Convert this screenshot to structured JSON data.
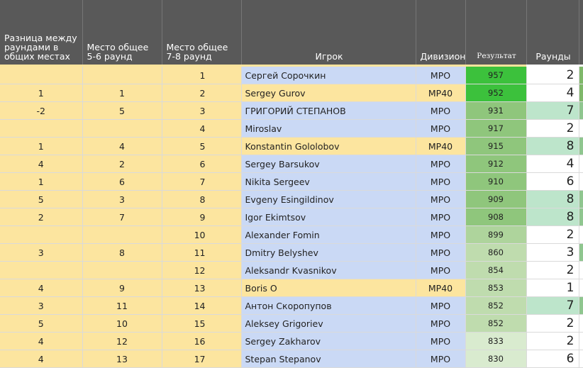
{
  "headers": {
    "diff": "Разница между раундами в общих местах",
    "place56": "Место общее 5-6 раунд",
    "place78": "Место общее 7-8 раунд",
    "player": "Игрок",
    "division": "Дивизион",
    "result": "Результат",
    "rounds": "Раунды"
  },
  "colors": {
    "header_bg": "#595959",
    "yellow": "#fce59f",
    "blue": "#cad9f5",
    "mint": "#bde5cb"
  },
  "rows": [
    {
      "diff": "",
      "p56": "",
      "p78": "1",
      "name": "Сергей Сорочкин",
      "division": "MPO",
      "result": "957",
      "rounds": "2"
    },
    {
      "diff": "1",
      "p56": "1",
      "p78": "2",
      "name": "Sergey Gurov",
      "division": "MP40",
      "result": "952",
      "rounds": "4"
    },
    {
      "diff": "-2",
      "p56": "5",
      "p78": "3",
      "name": "ГРИГОРИЙ СТЕПАНОВ",
      "division": "MPO",
      "result": "931",
      "rounds": "7"
    },
    {
      "diff": "",
      "p56": "",
      "p78": "4",
      "name": "Miroslav",
      "division": "MPO",
      "result": "917",
      "rounds": "2"
    },
    {
      "diff": "1",
      "p56": "4",
      "p78": "5",
      "name": "Konstantin Gololobov",
      "division": "MP40",
      "result": "915",
      "rounds": "8"
    },
    {
      "diff": "4",
      "p56": "2",
      "p78": "6",
      "name": "Sergey Barsukov",
      "division": "MPO",
      "result": "912",
      "rounds": "4"
    },
    {
      "diff": "1",
      "p56": "6",
      "p78": "7",
      "name": "Nikita Sergeev",
      "division": "MPO",
      "result": "910",
      "rounds": "6"
    },
    {
      "diff": "5",
      "p56": "3",
      "p78": "8",
      "name": "Evgeny Esingildinov",
      "division": "MPO",
      "result": "909",
      "rounds": "8"
    },
    {
      "diff": "2",
      "p56": "7",
      "p78": "9",
      "name": "Igor Ekimtsov",
      "division": "MPO",
      "result": "908",
      "rounds": "8"
    },
    {
      "diff": "",
      "p56": "",
      "p78": "10",
      "name": "Alexander Fomin",
      "division": "MPO",
      "result": "899",
      "rounds": "2"
    },
    {
      "diff": "3",
      "p56": "8",
      "p78": "11",
      "name": "Dmitry Belyshev",
      "division": "MPO",
      "result": "860",
      "rounds": "3"
    },
    {
      "diff": "",
      "p56": "",
      "p78": "12",
      "name": "Aleksandr Kvasnikov",
      "division": "MPO",
      "result": "854",
      "rounds": "2"
    },
    {
      "diff": "4",
      "p56": "9",
      "p78": "13",
      "name": "Boris O",
      "division": "MP40",
      "result": "853",
      "rounds": "1"
    },
    {
      "diff": "3",
      "p56": "11",
      "p78": "14",
      "name": "Антон Скоропупов",
      "division": "MPO",
      "result": "852",
      "rounds": "7"
    },
    {
      "diff": "5",
      "p56": "10",
      "p78": "15",
      "name": "Aleksey Grigoriev",
      "division": "MPO",
      "result": "852",
      "rounds": "2"
    },
    {
      "diff": "4",
      "p56": "12",
      "p78": "16",
      "name": "Sergey Zakharov",
      "division": "MPO",
      "result": "833",
      "rounds": "2"
    },
    {
      "diff": "4",
      "p56": "13",
      "p78": "17",
      "name": "Stepan Stepanov",
      "division": "MPO",
      "result": "830",
      "rounds": "6"
    }
  ]
}
